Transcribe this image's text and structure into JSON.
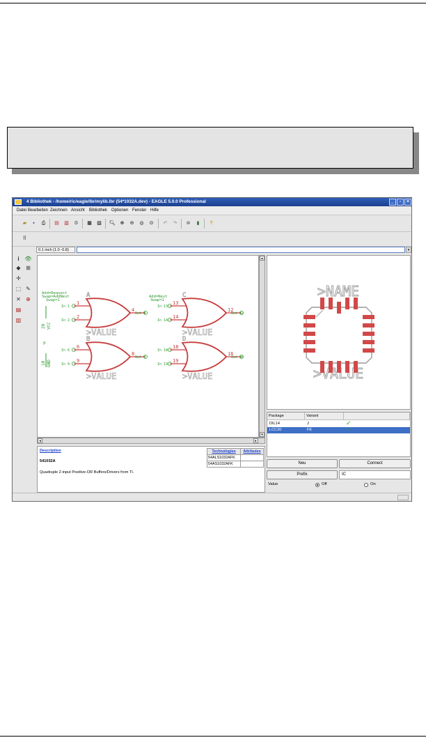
{
  "window": {
    "title": "4 Bibliothek - /home/ric/eagle/lbr/mylib.lbr (54*1032A.dev) - EAGLE 5.0.0 Professional",
    "controls": [
      "_",
      "▫",
      "×"
    ]
  },
  "menu": [
    "Datei",
    "Bearbeiten",
    "Zeichnen",
    "Ansicht",
    "Bibliothek",
    "Optionen",
    "Fenster",
    "Hilfe"
  ],
  "toolbar": {
    "icons": [
      "open-icon",
      "save-icon",
      "print-icon",
      "cam-icon",
      "script-icon",
      "run-icon",
      "grid-icon",
      "layer-icon",
      "zoom-fit-icon",
      "zoom-in-icon",
      "zoom-out-icon",
      "zoom-last-icon",
      "zoom-select-icon",
      "undo-icon",
      "redo-icon",
      "stop-icon",
      "go-icon",
      "help-icon"
    ]
  },
  "command": {
    "grid_label": "0.1 inch (1.0 -0.8)",
    "placeholder": ""
  },
  "schematic": {
    "gates": [
      {
        "label": "A",
        "in1": "In 1",
        "in2": "In 2",
        "out": "Out 4",
        "n1": "1",
        "n2": "2",
        "n3": "4",
        "value": ">VALUE"
      },
      {
        "label": "B",
        "in1": "In 6",
        "in2": "In 9",
        "out": "Out 8",
        "n1": "6",
        "n2": "9",
        "n3": "8",
        "value": ">VALUE"
      },
      {
        "label": "C",
        "in1": "In 13",
        "in2": "In 14",
        "out": "Out 12",
        "n1": "13",
        "n2": "14",
        "n3": "12",
        "value": ">VALUE"
      },
      {
        "label": "D",
        "in1": "In 18",
        "in2": "In 19",
        "out": "Out 16",
        "n1": "18",
        "n2": "19",
        "n3": "16",
        "value": ">VALUE"
      }
    ],
    "power": {
      "pin1": "20",
      "name1": "VCC",
      "label": "P",
      "pin2": "10",
      "name2": "GND"
    },
    "addlevels": [
      "Add=Request",
      "Swap=AddNext",
      "Swap=1",
      "Add=Next",
      "Swap=1"
    ]
  },
  "package_preview": {
    "name": ">NAME",
    "value": ">VALUE"
  },
  "package_table": {
    "headers": [
      "Package",
      "Variant",
      ""
    ],
    "rows": [
      {
        "package": "DIL14",
        "variant": "J",
        "check": "✓",
        "selected": false
      },
      {
        "package": "LCC20",
        "variant": "FK",
        "check": "✓",
        "selected": true
      }
    ]
  },
  "buttons": {
    "new": "Neu",
    "connect": "Connect",
    "prefix": "Prefix"
  },
  "prefix_value": "IC",
  "value_row": {
    "label": "Value",
    "off": "Off",
    "on": "On",
    "selected": "Off"
  },
  "description": {
    "title": "Description",
    "part": "541032A",
    "text": "Quadruple 2-input Positive-OR Buffers/Drivers from TI.",
    "tech_headers": [
      "Technologies",
      "Attributes"
    ],
    "technologies": [
      "54ALS1032AFK",
      "54AS1032AFK"
    ]
  },
  "colors": {
    "accent": "#3d6fc6",
    "symbol": "#c83c3c",
    "net": "#2e9a2e",
    "pad": "#d24848"
  }
}
